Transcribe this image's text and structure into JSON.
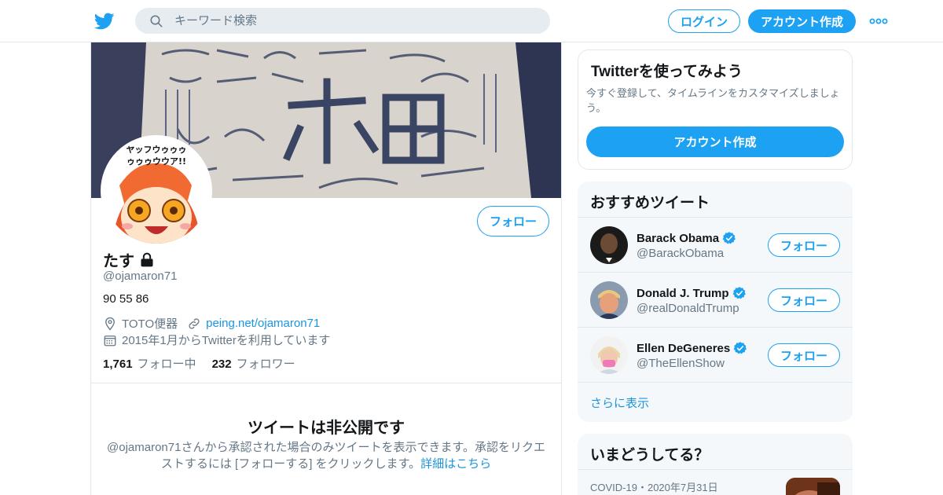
{
  "header": {
    "search_placeholder": "キーワード検索",
    "login_label": "ログイン",
    "signup_label": "アカウント作成"
  },
  "profile": {
    "follow_label": "フォロー",
    "display_name": "たす",
    "handle": "@ojamaron71",
    "bio": "90 55 86",
    "location": "TOTO便器",
    "link": "peing.net/ojamaron71",
    "joined": "2015年1月からTwitterを利用しています",
    "following_count": "1,761",
    "following_label": "フォロー中",
    "followers_count": "232",
    "followers_label": "フォロワー",
    "avatar_text": "ヤッフウゥゥゥ ゥゥゥウウア!!",
    "private_title": "ツイートは非公開です",
    "private_desc": "@ojamaron71さんから承認された場合のみツイートを表示できます。承認をリクエストするには [フォローする] をクリックします。",
    "private_link": "詳細はこちら"
  },
  "try_card": {
    "title": "Twitterを使ってみよう",
    "desc": "今すぐ登録して、タイムラインをカスタマイズしましょう。",
    "button": "アカウント作成"
  },
  "recommend": {
    "title": "おすすめツイート",
    "items": [
      {
        "name": "Barack Obama",
        "handle": "@BarackObama",
        "follow": "フォロー"
      },
      {
        "name": "Donald J. Trump",
        "handle": "@realDonaldTrump",
        "follow": "フォロー"
      },
      {
        "name": "Ellen DeGeneres",
        "handle": "@TheEllenShow",
        "follow": "フォロー"
      }
    ],
    "show_more": "さらに表示"
  },
  "happening": {
    "title": "いまどうしてる？",
    "meta": "COVID-19・2020年7月31日"
  },
  "colors": {
    "accent": "#1da1f2",
    "link": "#1b95e0",
    "verified": "#1da1f2"
  }
}
